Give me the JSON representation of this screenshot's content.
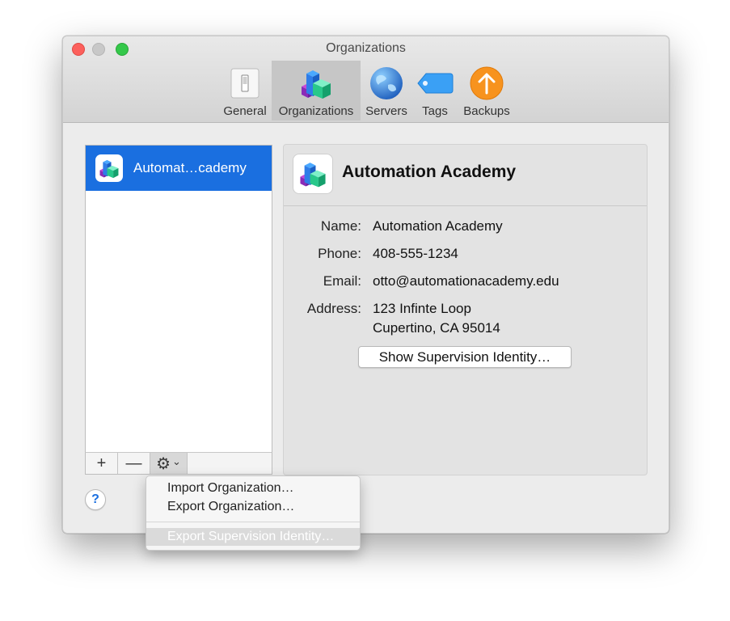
{
  "window": {
    "title": "Organizations"
  },
  "toolbar": {
    "items": [
      {
        "label": "General",
        "icon": "switch-icon"
      },
      {
        "label": "Organizations",
        "icon": "organizations-blocks-icon",
        "selected": true
      },
      {
        "label": "Servers",
        "icon": "globe-icon"
      },
      {
        "label": "Tags",
        "icon": "tag-icon"
      },
      {
        "label": "Backups",
        "icon": "backup-arrow-up-icon"
      }
    ]
  },
  "org_list": {
    "items": [
      {
        "label": "Automat…cademy",
        "selected": true
      }
    ],
    "add_label": "+",
    "remove_label": "—",
    "gear_label": "⚙",
    "gear_chevron": "⌄"
  },
  "detail": {
    "title": "Automation Academy",
    "name_label": "Name:",
    "name_value": "Automation Academy",
    "phone_label": "Phone:",
    "phone_value": "408-555-1234",
    "email_label": "Email:",
    "email_value": "otto@automationacademy.edu",
    "address_label": "Address:",
    "address_line1": "123 Infinte Loop",
    "address_line2": "Cupertino, CA 95014",
    "show_identity_label": "Show Supervision Identity…"
  },
  "help": {
    "label": "?"
  },
  "gear_menu": {
    "items": [
      {
        "label": "Import Organization…",
        "enabled": true
      },
      {
        "label": "Export Organization…",
        "enabled": true
      },
      {
        "label": "Export Supervision Identity…",
        "enabled": false
      }
    ]
  },
  "colors": {
    "selection_blue": "#1a6fe0",
    "close": "#fc605c",
    "maximize": "#34c84a"
  }
}
